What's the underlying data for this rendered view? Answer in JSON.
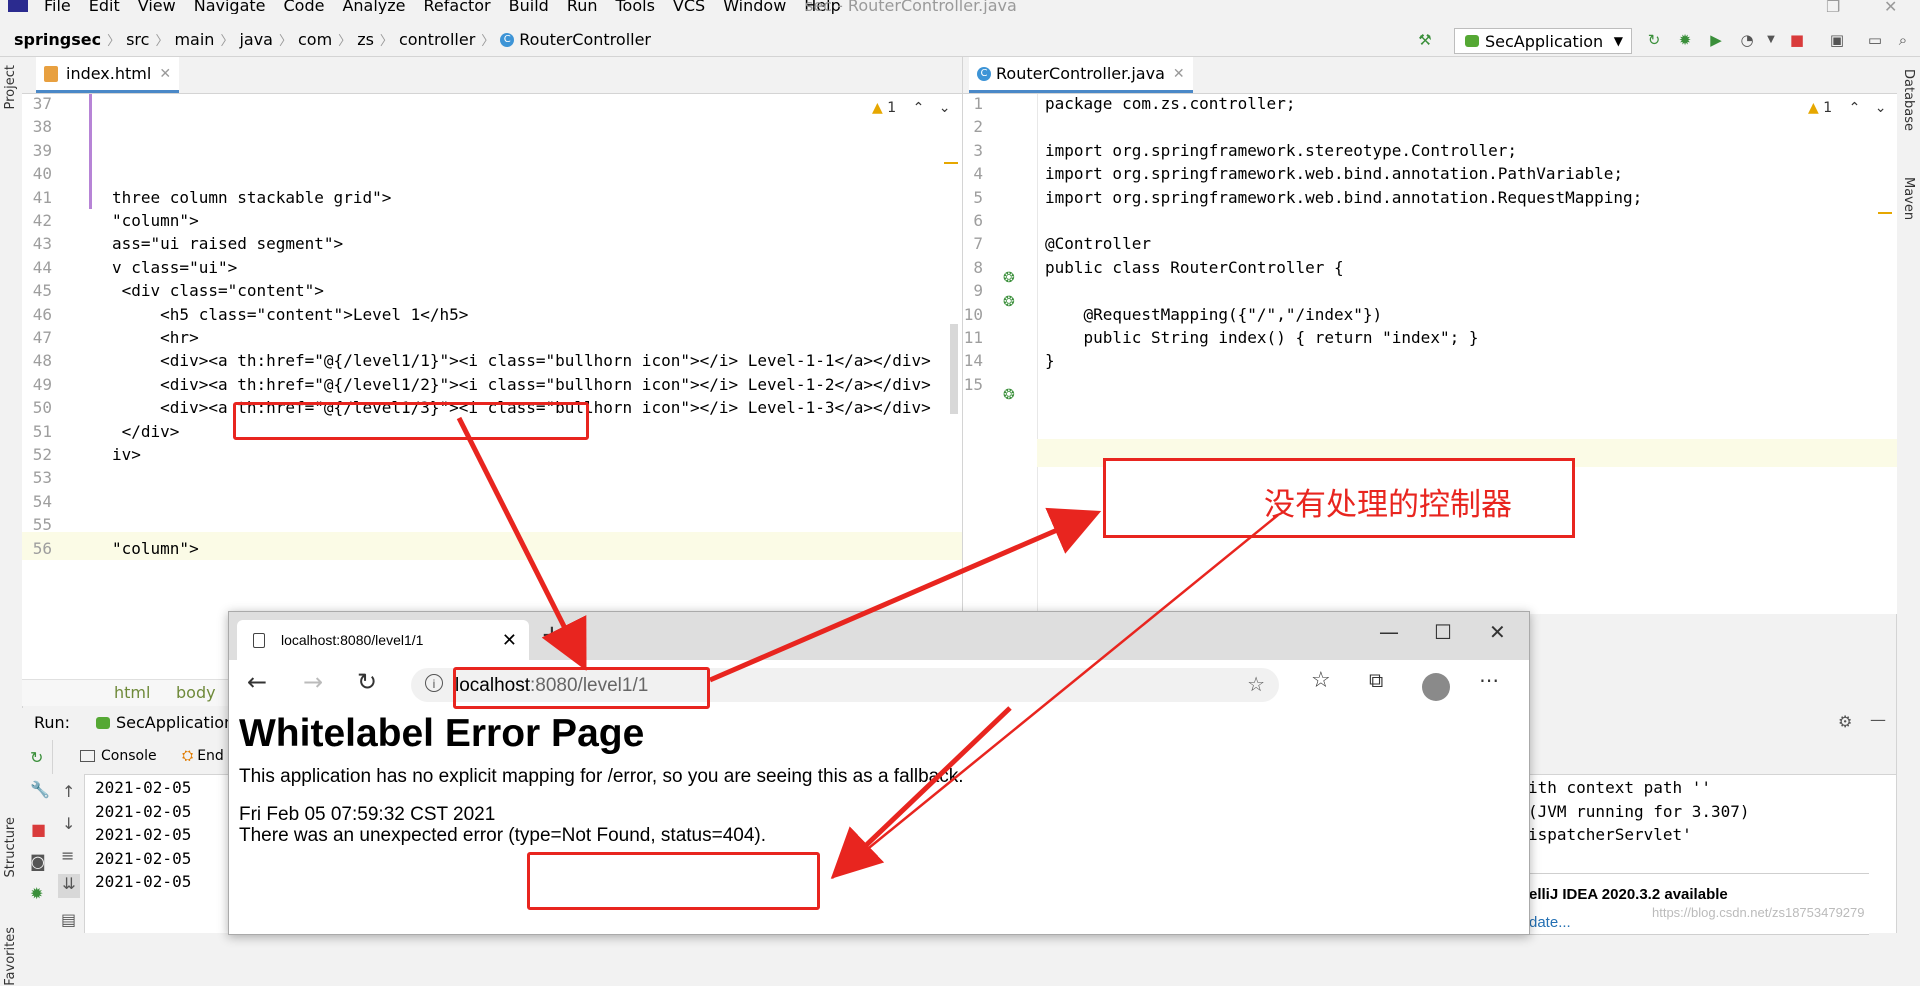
{
  "menubar": {
    "items": [
      "File",
      "Edit",
      "View",
      "Navigate",
      "Code",
      "Analyze",
      "Refactor",
      "Build",
      "Run",
      "Tools",
      "VCS",
      "Window",
      "Help"
    ],
    "window_title": "sec - RouterController.java"
  },
  "navbar": {
    "crumbs": [
      "springsec",
      "src",
      "main",
      "java",
      "com",
      "zs",
      "controller",
      "RouterController"
    ],
    "run_config": "SecApplication"
  },
  "side": {
    "project": "Project",
    "structure": "Structure",
    "favorites": "Favorites",
    "database": "Database",
    "maven": "Maven"
  },
  "left_editor": {
    "tab": "index.html",
    "warning_count": "1",
    "lines": [
      {
        "no": "37",
        "code": ""
      },
      {
        "no": "38",
        "code": ""
      },
      {
        "no": "39",
        "code": ""
      },
      {
        "no": "40",
        "code": ""
      },
      {
        "no": "41",
        "code": "three column stackable grid\">"
      },
      {
        "no": "42",
        "code": "\"column\">"
      },
      {
        "no": "43",
        "code": "ass=\"ui raised segment\">"
      },
      {
        "no": "44",
        "code": "v class=\"ui\">"
      },
      {
        "no": "45",
        "code": " <div class=\"content\">"
      },
      {
        "no": "46",
        "code": "     <h5 class=\"content\">Level 1</h5>"
      },
      {
        "no": "47",
        "code": "     <hr>"
      },
      {
        "no": "48",
        "code": "     <div><a th:href=\"@{/level1/1}\"><i class=\"bullhorn icon\"></i> Level-1-1</a></div>"
      },
      {
        "no": "49",
        "code": "     <div><a th:href=\"@{/level1/2}\"><i class=\"bullhorn icon\"></i> Level-1-2</a></div>"
      },
      {
        "no": "50",
        "code": "     <div><a th:href=\"@{/level1/3}\"><i class=\"bullhorn icon\"></i> Level-1-3</a></div>"
      },
      {
        "no": "51",
        "code": " </div>"
      },
      {
        "no": "52",
        "code": "iv>"
      },
      {
        "no": "53",
        "code": ""
      },
      {
        "no": "54",
        "code": ""
      },
      {
        "no": "55",
        "code": ""
      },
      {
        "no": "56",
        "code": "\"column\">"
      }
    ],
    "crumb": [
      "html",
      "body"
    ]
  },
  "right_editor": {
    "tab": "RouterController.java",
    "warning_count": "1",
    "lines": [
      {
        "no": "1",
        "code": "package com.zs.controller;"
      },
      {
        "no": "2",
        "code": ""
      },
      {
        "no": "3",
        "code": "import org.springframework.stereotype.Controller;"
      },
      {
        "no": "4",
        "code": "import org.springframework.web.bind.annotation.PathVariable;"
      },
      {
        "no": "5",
        "code": "import org.springframework.web.bind.annotation.RequestMapping;"
      },
      {
        "no": "6",
        "code": ""
      },
      {
        "no": "7",
        "code": "@Controller"
      },
      {
        "no": "8",
        "code": "public class RouterController {"
      },
      {
        "no": "9",
        "code": ""
      },
      {
        "no": "10",
        "code": "    @RequestMapping({\"/\",\"/index\"})"
      },
      {
        "no": "11",
        "code": "    public String index() { return \"index\"; }"
      },
      {
        "no": "14",
        "code": "}"
      },
      {
        "no": "15",
        "code": ""
      }
    ]
  },
  "run_panel": {
    "label": "Run:",
    "config": "SecApplication",
    "console_tab": "Console",
    "endpoints_tab": "End",
    "log_dates": [
      "2021-02-05",
      "2021-02-05",
      "2021-02-05",
      "2021-02-05",
      "2021-02-05"
    ],
    "log_right": [
      "ith context path ''",
      "(JVM running for 3.307)",
      "ispatcherServlet'"
    ],
    "notification_title": "elliJ IDEA 2020.3.2 available",
    "notification_link": "date..."
  },
  "browser": {
    "tab_title": "localhost:8080/level1/1",
    "url_host": "localhost",
    "url_rest": ":8080/level1/1",
    "heading": "Whitelabel Error Page",
    "message": "This application has no explicit mapping for /error, so you are seeing this as a fallback.",
    "date": "Fri Feb 05 07:59:32 CST 2021",
    "error": "There was an unexpected error (type=Not Found, status=404)."
  },
  "annotation": {
    "label": "没有处理的控制器",
    "color": "#e8251f"
  },
  "watermark": "https://blog.csdn.net/zs18753479279"
}
